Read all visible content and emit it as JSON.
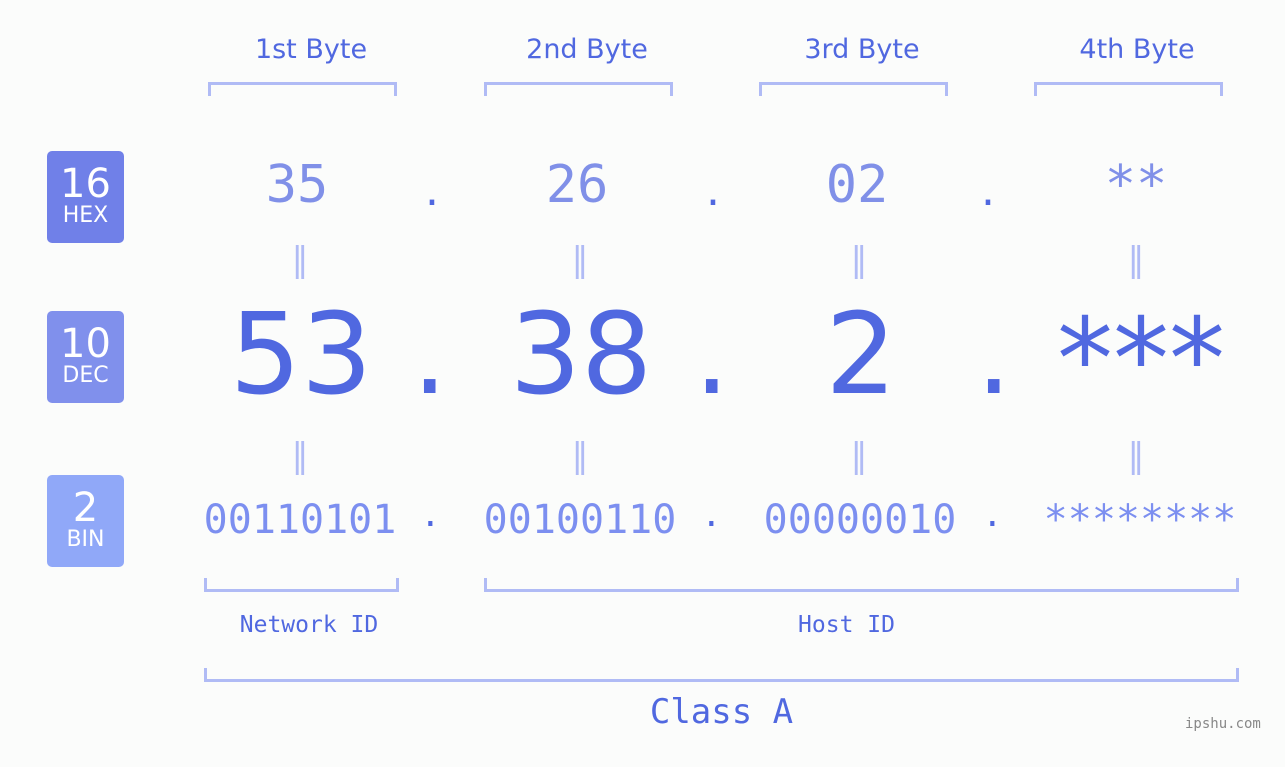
{
  "bytes": [
    {
      "label": "1st Byte",
      "hex": "35",
      "dec": "53",
      "bin": "00110101"
    },
    {
      "label": "2nd Byte",
      "hex": "26",
      "dec": "38",
      "bin": "00100110"
    },
    {
      "label": "3rd Byte",
      "hex": "02",
      "dec": "2",
      "bin": "00000010"
    },
    {
      "label": "4th Byte",
      "hex": "**",
      "dec": "***",
      "bin": "********"
    }
  ],
  "separator": ".",
  "equals_sign": "=",
  "badges": {
    "hex": {
      "num": "16",
      "sub": "HEX",
      "color": "#7080e8"
    },
    "dec": {
      "num": "10",
      "sub": "DEC",
      "color": "#8090ec"
    },
    "bin": {
      "num": "2",
      "sub": "BIN",
      "color": "#90a8f8"
    }
  },
  "network_id_label": "Network ID",
  "host_id_label": "Host ID",
  "class_label": "Class A",
  "watermark": "ipshu.com",
  "colors": {
    "accent": "#5068e0",
    "light": "#b0bbf5",
    "hex_text": "#8090e8"
  }
}
